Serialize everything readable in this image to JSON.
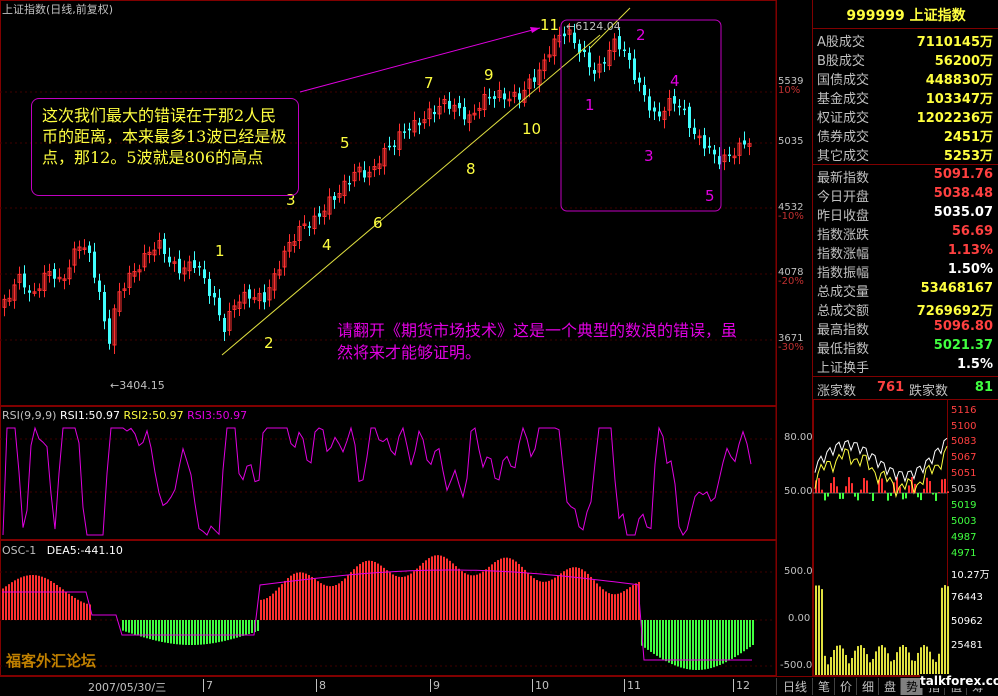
{
  "main_chart": {
    "title": "上证指数(日线,前复权)",
    "low_label": "←3404.15",
    "high_label": "←6124.04",
    "price_axis": [
      {
        "value": "5539",
        "pct": "10%",
        "color": "#c03030"
      },
      {
        "value": "5035",
        "pct": "",
        "color": "#c0c0c0"
      },
      {
        "value": "4532",
        "pct": "-10%",
        "color": "#c03030"
      },
      {
        "value": "4078",
        "pct": "-20%",
        "color": "#c03030"
      },
      {
        "value": "3671",
        "pct": "-30%",
        "color": "#c03030"
      }
    ],
    "wave_labels_left": [
      "1",
      "2",
      "3",
      "4",
      "5",
      "6",
      "7",
      "8",
      "9",
      "10",
      "11"
    ],
    "wave_labels_right": [
      "1",
      "2",
      "3",
      "4",
      "5"
    ],
    "annotation_1": "这次我们最大的错误在于那2人民币的距离，本来最多13波已经是极点，那12。5波就是806的高点",
    "annotation_2": "请翻开《期货市场技术》这是一个典型的数浪的错误，虽然将来才能够证明。"
  },
  "rsi": {
    "title": "RSI(9,9,9)",
    "rsi1": "RSI1:50.97",
    "rsi2": "RSI2:50.97",
    "rsi3": "RSI3:50.97",
    "axis": [
      "80.00",
      "50.00"
    ]
  },
  "osc": {
    "title": "OSC-1",
    "dea": "DEA5:-441.10",
    "axis": [
      "500.0",
      "0.00",
      "-500.0"
    ]
  },
  "date_axis": {
    "start": "2007/05/30/三",
    "months": [
      "7",
      "8",
      "9",
      "10",
      "11",
      "12"
    ]
  },
  "sidebar": {
    "header": "999999 上证指数",
    "volumes": [
      {
        "label": "A股成交",
        "value": "7110145万"
      },
      {
        "label": "B股成交",
        "value": "56200万"
      },
      {
        "label": "国债成交",
        "value": "448830万"
      },
      {
        "label": "基金成交",
        "value": "103347万"
      },
      {
        "label": "权证成交",
        "value": "1202236万"
      },
      {
        "label": "债券成交",
        "value": "2451万"
      },
      {
        "label": "其它成交",
        "value": "5253万"
      }
    ],
    "quotes": [
      {
        "label": "最新指数",
        "value": "5091.76",
        "color": "#ff4040"
      },
      {
        "label": "今日开盘",
        "value": "5038.48",
        "color": "#ff4040"
      },
      {
        "label": "昨日收盘",
        "value": "5035.07",
        "color": "#ffffff"
      },
      {
        "label": "指数涨跌",
        "value": "56.69",
        "color": "#ff4040"
      },
      {
        "label": "指数涨幅",
        "value": "1.13%",
        "color": "#ff4040"
      },
      {
        "label": "指数振幅",
        "value": "1.50%",
        "color": "#ffffff"
      },
      {
        "label": "总成交量",
        "value": "53468167",
        "color": "#ffff40"
      },
      {
        "label": "总成交额",
        "value": "7269692万",
        "color": "#ffff40"
      },
      {
        "label": "最高指数",
        "value": "5096.80",
        "color": "#ff4040"
      },
      {
        "label": "最低指数",
        "value": "5021.37",
        "color": "#40ff40"
      },
      {
        "label": "上证换手",
        "value": "1.5%",
        "color": "#ffffff"
      }
    ],
    "rise_label": "涨家数",
    "rise_value": "761",
    "fall_label": "跌家数",
    "fall_value": "81",
    "mini_axis": [
      "5116",
      "5100",
      "5083",
      "5067",
      "5051",
      "5035",
      "5019",
      "5003",
      "4987",
      "4971",
      "10.27万",
      "76443",
      "50962",
      "25481"
    ]
  },
  "bottom_tabs": [
    "日线",
    "笔",
    "价",
    "细",
    "盘",
    "势",
    "指",
    "值",
    "筹"
  ],
  "active_tab": "势",
  "watermark": {
    "name": "福客外汇论坛",
    "url": "talkforex.com"
  }
}
